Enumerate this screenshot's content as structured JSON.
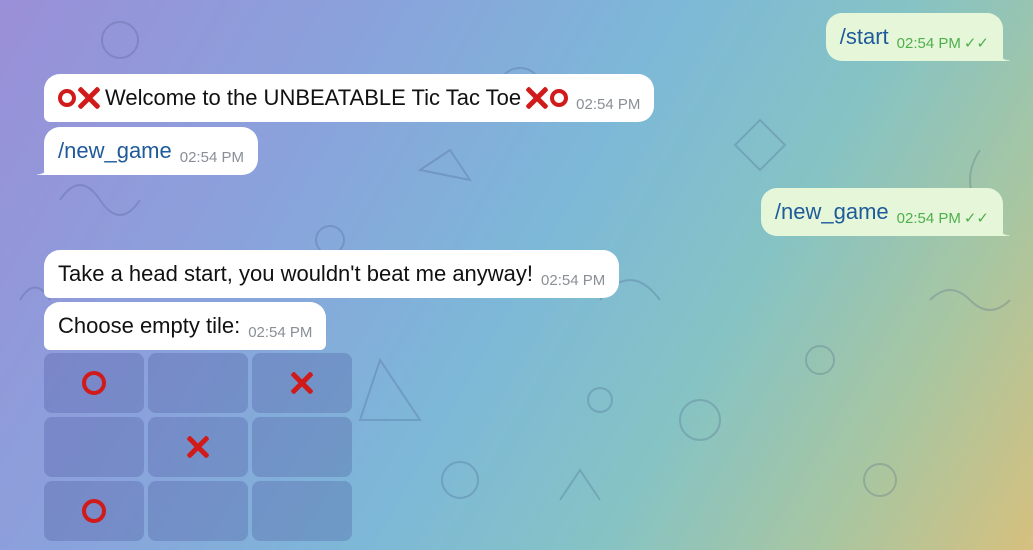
{
  "messages": [
    {
      "id": "m1",
      "side": "out",
      "text": "/start",
      "command": true,
      "time": "02:54 PM",
      "read": "✓✓"
    },
    {
      "id": "m2",
      "side": "in",
      "text": "Welcome to the UNBEATABLE Tic Tac Toe",
      "time": "02:54 PM"
    },
    {
      "id": "m3",
      "side": "in",
      "text": "/new_game",
      "command": true,
      "time": "02:54 PM"
    },
    {
      "id": "m4",
      "side": "out",
      "text": "/new_game",
      "command": true,
      "time": "02:54 PM",
      "read": "✓✓"
    },
    {
      "id": "m5",
      "side": "in",
      "text": "Take a head start, you wouldn't beat me anyway!",
      "time": "02:54 PM"
    },
    {
      "id": "m6",
      "side": "in",
      "text": "Choose empty tile:",
      "time": "02:54 PM"
    }
  ],
  "welcome_emoji": {
    "before": [
      "o",
      "x"
    ],
    "after": [
      "x",
      "o"
    ]
  },
  "board": [
    [
      "o",
      "",
      "x"
    ],
    [
      "",
      "x",
      ""
    ],
    [
      "o",
      "",
      ""
    ]
  ],
  "colors": {
    "accent": "#d11a1a",
    "link": "#1e5b9a",
    "read_check": "#4fae4e",
    "outgoing_bubble": "#e6f7d9"
  }
}
